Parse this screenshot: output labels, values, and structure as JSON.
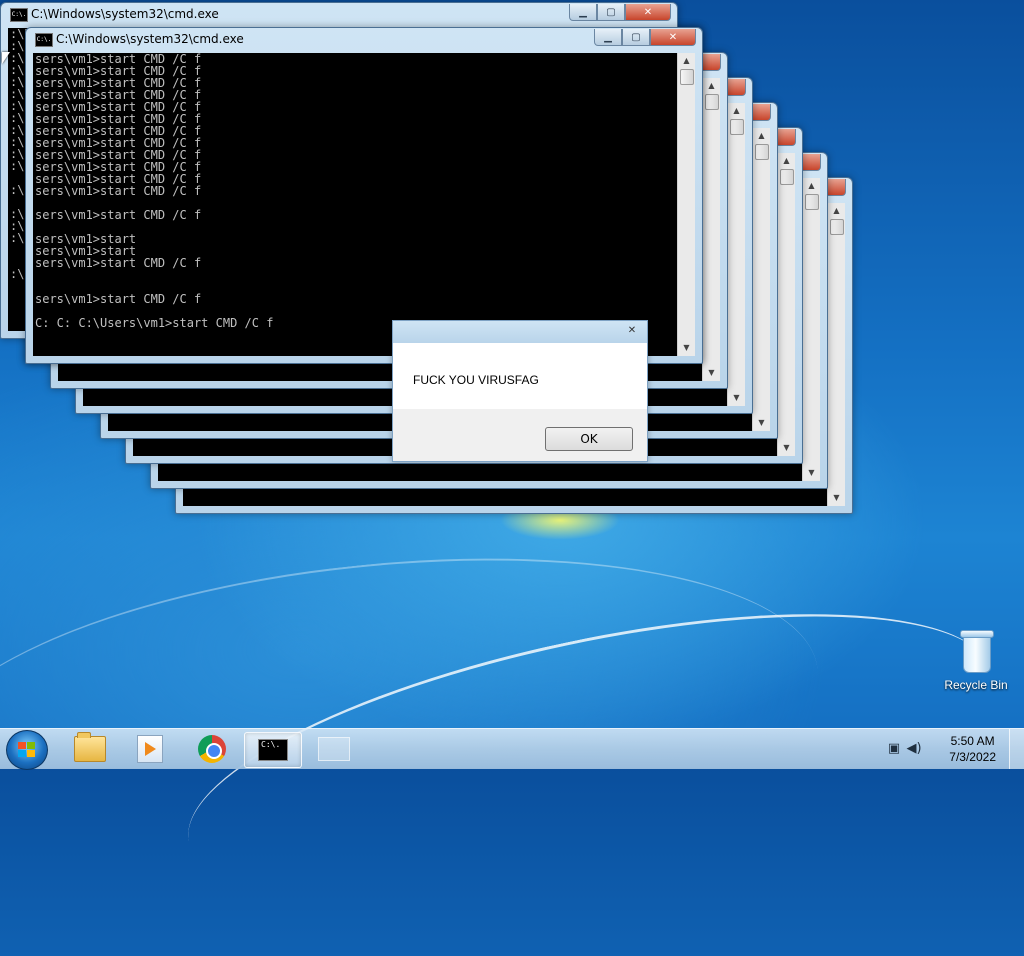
{
  "desktop": {
    "recycle_bin_label": "Recycle Bin"
  },
  "cmd_window": {
    "title": "C:\\Windows\\system32\\cmd.exe",
    "icon_text": "C:\\."
  },
  "console": {
    "back_window_lines": [
      ":\\Users\\vm1>start CMD /C f",
      ":\\Users\\vm1>start CMD /C f",
      ":\\Users\\vm1>start CMD /C f",
      ":\\Users\\vm1>start CMD /C f",
      ":\\Users\\vm1>start CMD /C f",
      ":\\Users\\vm1>start CMD /C f",
      ":\\Users\\vm1>start CMD /C f",
      ":\\Users\\vm1>start CMD /C f",
      ":\\Users\\vm1>start CMD /C f",
      ":\\Users\\vm1>start CMD /C f",
      ":\\Users\\vm1>start CMD /C f",
      ":\\Users\\vm1>start CMD /C f",
      "",
      ":\\Users\\vm1>start CMD /C f",
      "",
      ":\\Users\\vm1>start",
      ":\\Users\\vm1>start",
      ":\\Users\\vm1>start CMD /C f",
      "",
      "",
      ":\\Users\\vm1>start CMD /C f"
    ],
    "front_window_lines": [
      "sers\\vm1>start CMD /C f",
      "sers\\vm1>start CMD /C f",
      "sers\\vm1>start CMD /C f",
      "sers\\vm1>start CMD /C f",
      "sers\\vm1>start CMD /C f",
      "sers\\vm1>start CMD /C f",
      "sers\\vm1>start CMD /C f",
      "sers\\vm1>start CMD /C f",
      "sers\\vm1>start CMD /C f",
      "sers\\vm1>start CMD /C f",
      "sers\\vm1>start CMD /C f",
      "sers\\vm1>start CMD /C f",
      "",
      "sers\\vm1>start CMD /C f",
      "",
      "sers\\vm1>start",
      "sers\\vm1>start",
      "sers\\vm1>start CMD /C f",
      "",
      "",
      "sers\\vm1>start CMD /C f",
      "",
      "C: C: C:\\Users\\vm1>start CMD /C f"
    ]
  },
  "message_box": {
    "text": "FUCK YOU VIRUSFAG",
    "ok_label": "OK"
  },
  "taskbar": {
    "start_label": "Start",
    "apps": [
      "Windows Explorer",
      "Windows Media Player",
      "Google Chrome",
      "Command Prompt",
      "Window"
    ]
  },
  "tray": {
    "time": "5:50 AM",
    "date": "7/3/2022"
  }
}
